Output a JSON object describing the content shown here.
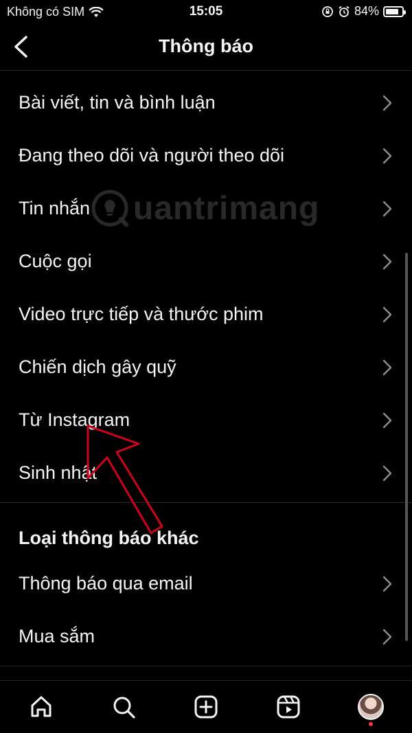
{
  "status_bar": {
    "carrier": "Không có SIM",
    "time": "15:05",
    "battery": "84%",
    "battery_level": 0.84
  },
  "header": {
    "title": "Thông báo"
  },
  "main_items": [
    {
      "label": "Bài viết, tin và bình luận"
    },
    {
      "label": "Đang theo dõi và người theo dõi"
    },
    {
      "label": "Tin nhắn"
    },
    {
      "label": "Cuộc gọi"
    },
    {
      "label": "Video trực tiếp và thước phim"
    },
    {
      "label": "Chiến dịch gây quỹ"
    },
    {
      "label": "Từ Instagram"
    },
    {
      "label": "Sinh nhật"
    }
  ],
  "other_section": {
    "title": "Loại thông báo khác",
    "items": [
      {
        "label": "Thông báo qua email"
      },
      {
        "label": "Mua sắm"
      }
    ]
  },
  "watermark": {
    "text": "uantrimang"
  },
  "tabbar": {
    "items": [
      "home-icon",
      "search-icon",
      "create-icon",
      "reels-icon",
      "profile-avatar"
    ]
  },
  "colors": {
    "background": "#000000",
    "text": "#f5f5f5",
    "divider": "#262626",
    "annotation": "#d0021b",
    "notification_dot": "#ff3040"
  }
}
